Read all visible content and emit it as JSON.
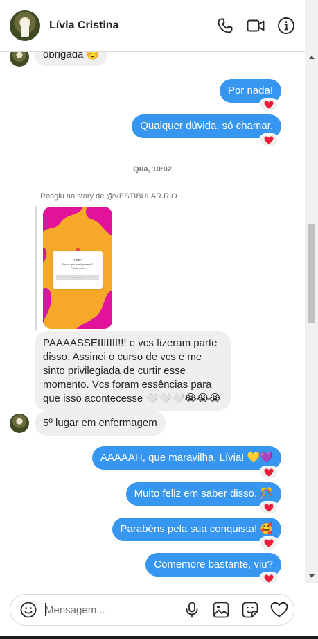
{
  "header": {
    "contact_name": "Lívia Cristina",
    "icons": [
      "phone-icon",
      "video-icon",
      "info-icon"
    ]
  },
  "messages": {
    "m0": "obrigada ☺️",
    "m1": "Por nada!",
    "m2": "Qualquer dúvida, só chamar.",
    "timestamp": "Qua, 10:02",
    "story_caption": "Reagiu ao story de @VESTIBULAR.RIO",
    "story_text_1": "Fala!!!",
    "story_text_2": "Como que você passou?",
    "story_text_3": "Conta nos!",
    "story_button": "Fale aqui",
    "m3": "PAAAASSEIIIIIII!!! e vcs fizeram parte disso. Assinei o curso de vcs e me sinto privilegiada de curtir esse momento. Vcs foram essências para que isso acontecesse 🤍🤍🤍😭😭😭",
    "m4": "5º lugar em enfermagem",
    "m5": "AAAAAH, que maravilha, Lívia! 💛💜",
    "m6": "Muito feliz em saber disso. 🎊",
    "m7": "Parabéns pela sua conquista! 🥰",
    "m8": "Comemore bastante, viu?"
  },
  "reaction": "heart",
  "composer": {
    "placeholder": "Mensagem...",
    "icons": [
      "emoji-icon",
      "microphone-icon",
      "image-icon",
      "sticker-icon",
      "heart-icon"
    ]
  },
  "colors": {
    "outgoing_bubble": "#3797f0",
    "incoming_bubble": "#efefef",
    "heart": "#ed1c3b"
  }
}
